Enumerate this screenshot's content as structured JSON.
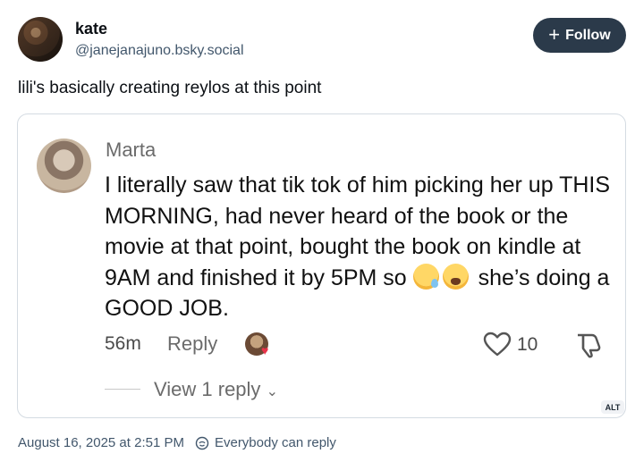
{
  "author": {
    "display_name": "kate",
    "handle": "@janejanajuno.bsky.social",
    "follow_label": "Follow"
  },
  "post": {
    "text": "lili's basically creating reylos at this point",
    "date": "August 16, 2025 at 2:51 PM",
    "reply_setting": "Everybody can reply"
  },
  "embedded": {
    "alt_label": "ALT",
    "comment": {
      "name": "Marta",
      "text": "I literally saw that tik tok of him picking her up THIS MORNING, had never heard of the book or the movie at that point, bought the book on kindle at 9AM and finished it by 5PM so",
      "text_after_emoji": "she’s doing a GOOD JOB.",
      "emojis": [
        "sleepy-face",
        "weary-face"
      ],
      "time": "56m",
      "reply_label": "Reply",
      "likes": "10",
      "view_replies": "View 1 reply"
    }
  },
  "colors": {
    "follow_bg": "#2b3a4a",
    "muted_text": "#42576c",
    "heart_red": "#e8334a"
  }
}
